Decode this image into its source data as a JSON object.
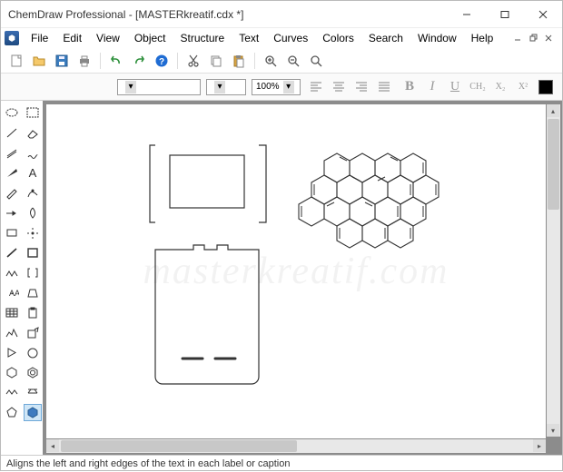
{
  "window": {
    "title": "ChemDraw Professional - [MASTERkreatif.cdx *]"
  },
  "menu": {
    "items": [
      "File",
      "Edit",
      "View",
      "Object",
      "Structure",
      "Text",
      "Curves",
      "Colors",
      "Search",
      "Window",
      "Help"
    ]
  },
  "toolbar2": {
    "font": "",
    "size": "",
    "zoom": "100%"
  },
  "formatting": {
    "bold": "B",
    "italic": "I",
    "underline": "U",
    "formula": "CH₂",
    "subscript": "X₂",
    "superscript": "X²"
  },
  "statusbar": {
    "text": "Aligns the left and right edges of the text in each label or caption"
  },
  "watermark": "masterkreatif.com"
}
